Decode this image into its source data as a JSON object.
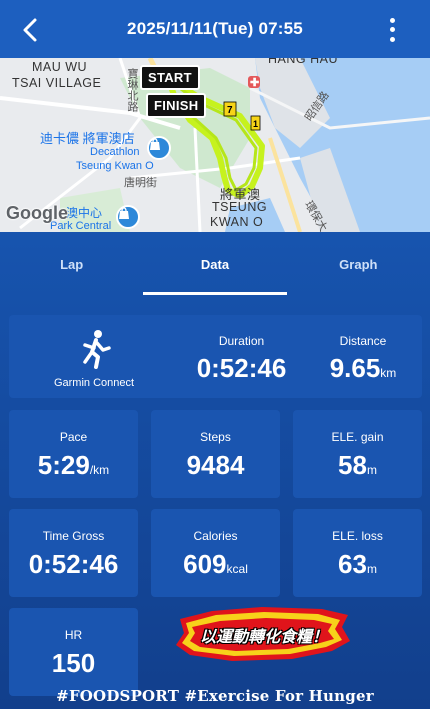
{
  "header": {
    "title": "2025/11/11(Tue) 07:55"
  },
  "map": {
    "labels": {
      "mau_wu": "MAU WU",
      "tsai_village": "TSAI VILLAGE",
      "hang_hau": "HANG HAU",
      "decathlon_cjk": "迪卡儂 將軍澳店",
      "decathlon": "Decathlon",
      "decathlon_area": "Tseung Kwan O",
      "tsko_cjk": "將軍澳",
      "tseung": "TSEUNG",
      "kwan_o": "KWAN O",
      "road1": "唐明街",
      "road2": "昭信路",
      "road3": "環保大",
      "park_cjk": "澳中心",
      "park": "Park Central",
      "street_top": "寶琳北路"
    },
    "start_label": "START",
    "finish_label": "FINISH",
    "google": "Google",
    "route_color": "#c6f21e"
  },
  "tabs": [
    {
      "label": "Lap"
    },
    {
      "label": "Data"
    },
    {
      "label": "Graph"
    }
  ],
  "stats": {
    "source": "Garmin Connect",
    "duration": {
      "label": "Duration",
      "value": "0:52:46"
    },
    "distance": {
      "label": "Distance",
      "value": "9.65",
      "unit": "km"
    },
    "pace": {
      "label": "Pace",
      "value": "5:29",
      "unit": "/km"
    },
    "steps": {
      "label": "Steps",
      "value": "9484"
    },
    "ele_gain": {
      "label": "ELE. gain",
      "value": "58",
      "unit": "m"
    },
    "time_gross": {
      "label": "Time Gross",
      "value": "0:52:46"
    },
    "calories": {
      "label": "Calories",
      "value": "609",
      "unit": "kcal"
    },
    "ele_loss": {
      "label": "ELE. loss",
      "value": "63",
      "unit": "m"
    },
    "hr": {
      "label": "HR",
      "value": "150"
    }
  },
  "banner": {
    "text": "以運動轉化食糧！"
  },
  "footer": "#FOODSPORT #Exercise For Hunger"
}
